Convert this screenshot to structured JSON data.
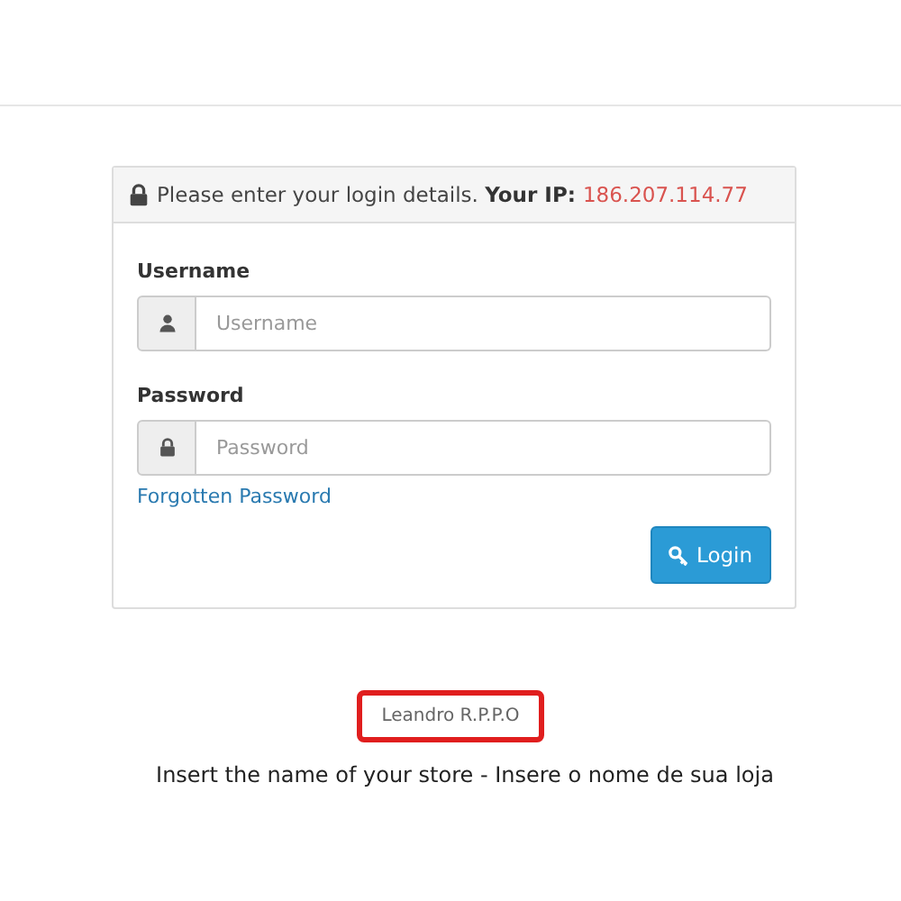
{
  "panel": {
    "heading": "Please enter your login details. **Your IP:**",
    "ip": "186.207.114.77",
    "fields": [
      {
        "label": "Username",
        "placeholder": "Username",
        "kind": "user"
      },
      {
        "label": "Password",
        "placeholder": "Password",
        "kind": "password"
      }
    ],
    "forgot_link": "Forgotten Password",
    "login_button": "Login"
  },
  "store_name": "Leandro R.P.P.O",
  "caption": "Insert the name of your store - Insere o nome de sua loja"
}
